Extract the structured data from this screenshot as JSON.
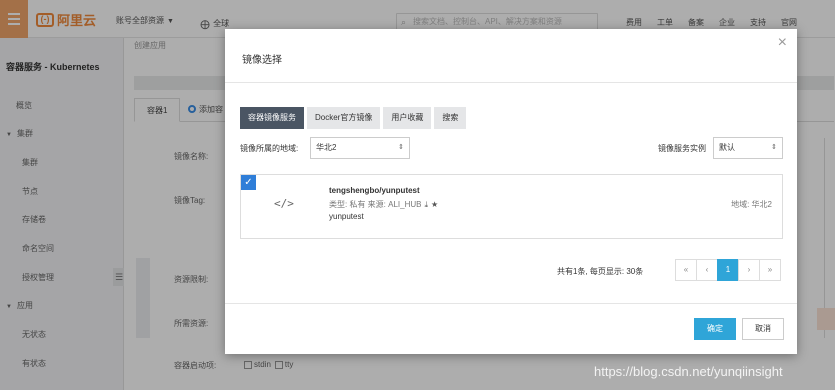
{
  "topbar": {
    "logo_text": "阿里云",
    "logo_bracket": "(-)",
    "account": "账号全部资源",
    "region": "全球",
    "search_placeholder": "搜索文档、控制台、API、解决方案和资源",
    "nav": [
      "费用",
      "工单",
      "备案",
      "企业",
      "支持",
      "官网"
    ]
  },
  "sidebar": {
    "title": "容器服务 - Kubernetes",
    "overview": "概览",
    "cluster_group": "集群",
    "cluster_items": [
      "集群",
      "节点",
      "存储卷",
      "命名空间",
      "授权管理"
    ],
    "app_group": "应用",
    "app_items": [
      "无状态",
      "有状态"
    ],
    "toggle": "☰"
  },
  "background": {
    "breadcrumb": "创建应用",
    "tab1": "容器1",
    "tab2": "添加容",
    "labels": [
      "镜像名称:",
      "镜像Tag:",
      "资源限制:",
      "所需资源:",
      "容器启动项:"
    ],
    "stdin": "stdin",
    "tty": "tty"
  },
  "modal": {
    "title": "镜像选择",
    "close": "×",
    "tabs": [
      "容器镜像服务",
      "Docker官方镜像",
      "用户收藏",
      "搜索"
    ],
    "active_tab": 0,
    "region_label": "镜像所属的地域:",
    "region_value": "华北2",
    "instance_label": "镜像服务实例",
    "instance_value": "默认",
    "result": {
      "checked": true,
      "icon_text": "</>",
      "name": "tengshengbo/yunputest",
      "meta": "类型: 私有  来源: ALI_HUB",
      "description": "yunputest",
      "region": "地域: 华北2"
    },
    "pagination": {
      "summary": "共有1条, 每页显示: 30条",
      "first": "«",
      "prev": "‹",
      "current": "1",
      "next": "›",
      "last": "»"
    },
    "ok_button": "确定",
    "cancel_button": "取消"
  },
  "watermark": "https://blog.csdn.net/yunqiinsight",
  "colors": {
    "brand_orange": "#f08a3c",
    "primary_blue": "#2fa5d8",
    "active_tab": "#4a5563"
  }
}
